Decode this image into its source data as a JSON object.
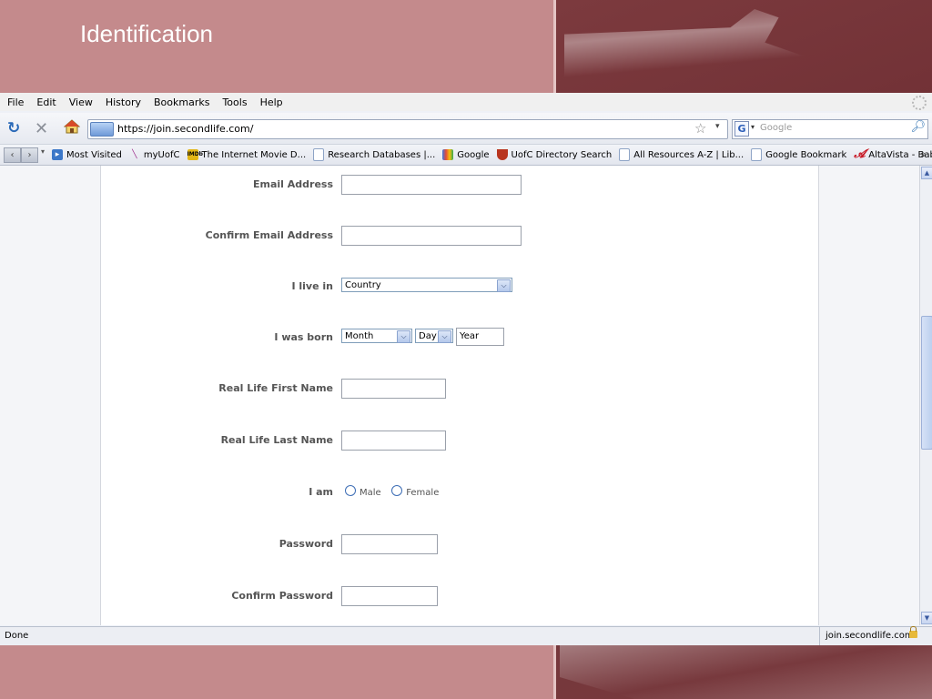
{
  "slide": {
    "title": "Identification"
  },
  "menu": [
    "File",
    "Edit",
    "View",
    "History",
    "Bookmarks",
    "Tools",
    "Help"
  ],
  "nav": {
    "url": "https://join.secondlife.com/",
    "search_placeholder": "Google",
    "search_engine_letter": "G"
  },
  "bookmarks": [
    {
      "label": "Most Visited",
      "icon": "most-visited-icon",
      "color": "#3b77c8"
    },
    {
      "label": "myUofC",
      "icon": "feather-icon",
      "color": "#9c2a8a"
    },
    {
      "label": "The Internet Movie D...",
      "icon": "imdb-icon",
      "color": "#e2b616"
    },
    {
      "label": "Research Databases |...",
      "icon": "page-icon",
      "color": "#c8d4e6"
    },
    {
      "label": "Google",
      "icon": "google-icon",
      "color": "#3f7be0"
    },
    {
      "label": "UofC Directory Search",
      "icon": "crest-icon",
      "color": "#b8341e"
    },
    {
      "label": "All Resources A-Z | Lib...",
      "icon": "page-icon",
      "color": "#c8d4e6"
    },
    {
      "label": "Google Bookmark",
      "icon": "page-icon",
      "color": "#c8d4e6"
    },
    {
      "label": "AltaVista - Babel Fish ...",
      "icon": "altavista-icon",
      "color": "#c81c28"
    }
  ],
  "form": {
    "email_label": "Email Address",
    "email_value": "",
    "confirm_email_label": "Confirm Email Address",
    "confirm_email_value": "",
    "country_label": "I live in",
    "country_value": "Country",
    "born_label": "I was born",
    "month_value": "Month",
    "day_value": "Day",
    "year_value": "Year",
    "first_name_label": "Real Life First Name",
    "first_name_value": "",
    "last_name_label": "Real Life Last Name",
    "last_name_value": "",
    "gender_label": "I am",
    "male_label": "Male",
    "female_label": "Female",
    "password_label": "Password",
    "password_value": "",
    "confirm_password_label": "Confirm Password",
    "confirm_password_value": ""
  },
  "status": {
    "text": "Done",
    "host": "join.secondlife.com"
  }
}
